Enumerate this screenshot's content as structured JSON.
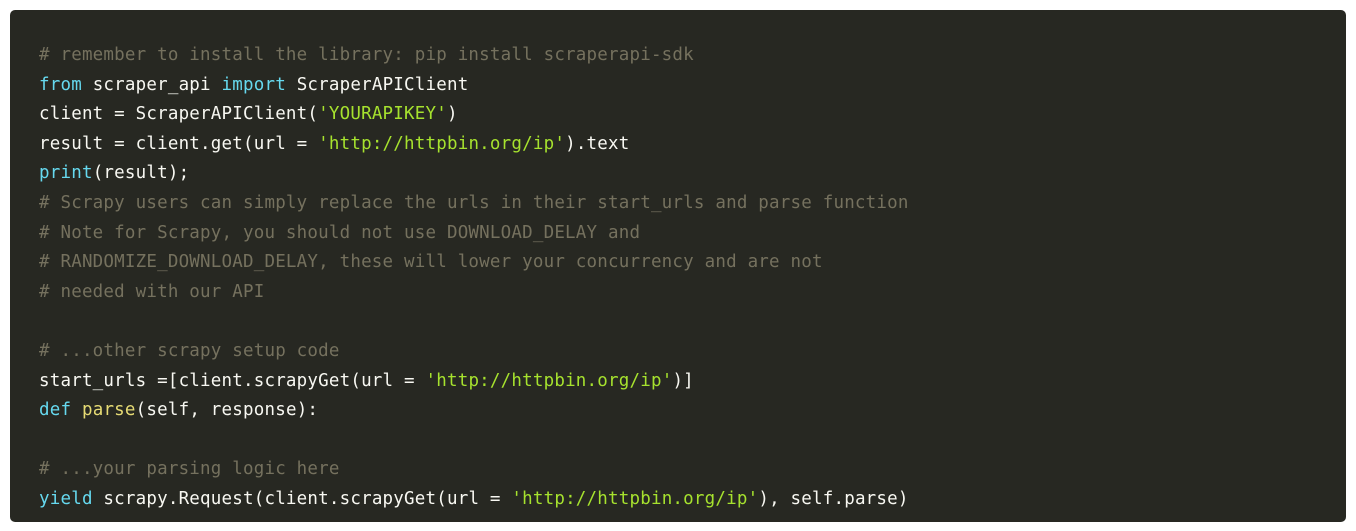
{
  "colors": {
    "background": "#272822",
    "page": "#ffffff",
    "plain": "#f8f8f2",
    "comment": "#75715e",
    "keyword": "#66d9ef",
    "string": "#a6e22e",
    "function": "#e6db74"
  },
  "code": {
    "language": "python",
    "lines": [
      [
        {
          "t": "comment",
          "v": "# remember to install the library: pip install scraperapi-sdk"
        }
      ],
      [
        {
          "t": "keyword",
          "v": "from"
        },
        {
          "t": "plain",
          "v": " scraper_api "
        },
        {
          "t": "keyword",
          "v": "import"
        },
        {
          "t": "plain",
          "v": " ScraperAPIClient"
        }
      ],
      [
        {
          "t": "plain",
          "v": "client = ScraperAPIClient("
        },
        {
          "t": "string",
          "v": "'YOURAPIKEY'"
        },
        {
          "t": "plain",
          "v": ")"
        }
      ],
      [
        {
          "t": "plain",
          "v": "result = client.get(url = "
        },
        {
          "t": "string",
          "v": "'http://httpbin.org/ip'"
        },
        {
          "t": "plain",
          "v": ").text"
        }
      ],
      [
        {
          "t": "keyword",
          "v": "print"
        },
        {
          "t": "plain",
          "v": "(result);"
        }
      ],
      [
        {
          "t": "comment",
          "v": "# Scrapy users can simply replace the urls in their start_urls and parse function"
        }
      ],
      [
        {
          "t": "comment",
          "v": "# Note for Scrapy, you should not use DOWNLOAD_DELAY and"
        }
      ],
      [
        {
          "t": "comment",
          "v": "# RANDOMIZE_DOWNLOAD_DELAY, these will lower your concurrency and are not"
        }
      ],
      [
        {
          "t": "comment",
          "v": "# needed with our API"
        }
      ],
      [],
      [
        {
          "t": "comment",
          "v": "# ...other scrapy setup code"
        }
      ],
      [
        {
          "t": "plain",
          "v": "start_urls =[client.scrapyGet(url = "
        },
        {
          "t": "string",
          "v": "'http://httpbin.org/ip'"
        },
        {
          "t": "plain",
          "v": ")]"
        }
      ],
      [
        {
          "t": "keyword",
          "v": "def"
        },
        {
          "t": "plain",
          "v": " "
        },
        {
          "t": "func",
          "v": "parse"
        },
        {
          "t": "plain",
          "v": "(self, response):"
        }
      ],
      [],
      [
        {
          "t": "comment",
          "v": "# ...your parsing logic here"
        }
      ],
      [
        {
          "t": "keyword",
          "v": "yield"
        },
        {
          "t": "plain",
          "v": " scrapy.Request(client.scrapyGet(url = "
        },
        {
          "t": "string",
          "v": "'http://httpbin.org/ip'"
        },
        {
          "t": "plain",
          "v": "), self.parse)"
        }
      ]
    ]
  }
}
